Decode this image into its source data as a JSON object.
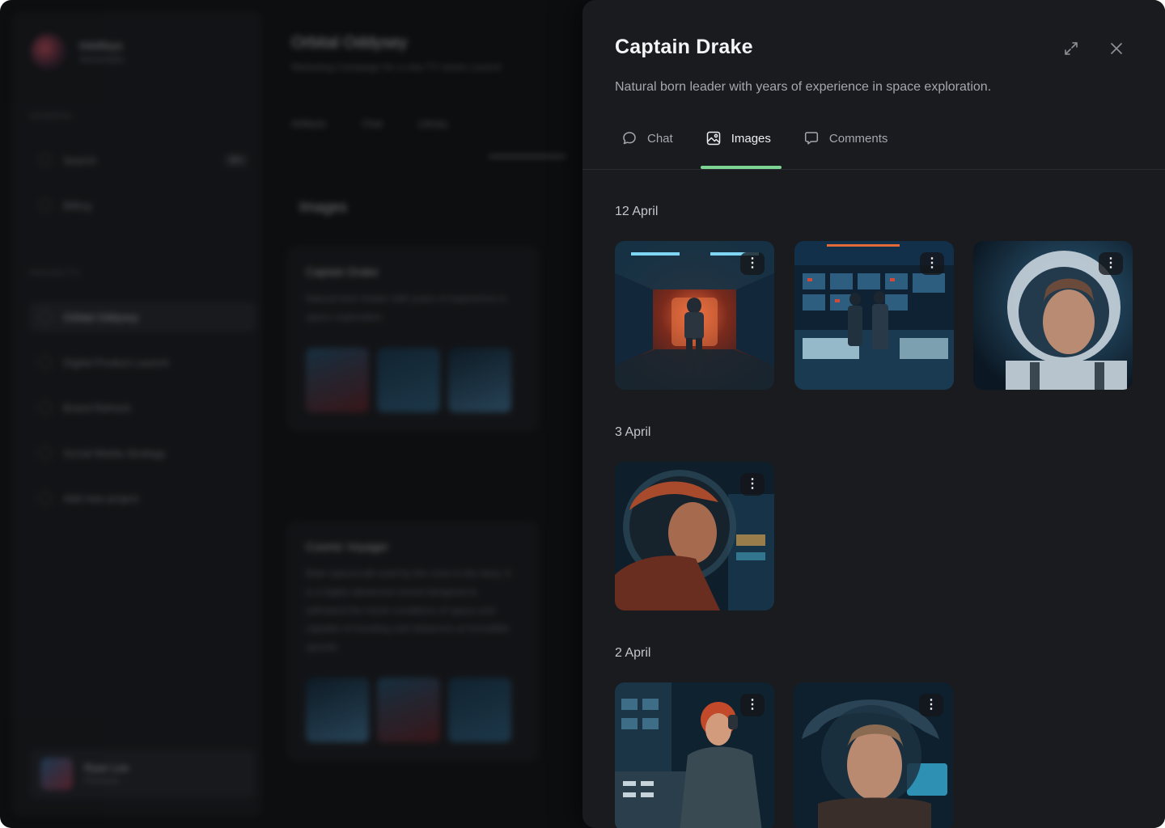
{
  "background_app": {
    "workspace": {
      "name": "Intellisys",
      "sub": "Streamlabs"
    },
    "sections": {
      "general": "GENERAL",
      "projects": "PROJECTS"
    },
    "nav": [
      {
        "label": "Search",
        "kbd": "⌘K"
      },
      {
        "label": "Billing"
      }
    ],
    "projects": [
      {
        "label": "Orbital Oddysey",
        "active": true
      },
      {
        "label": "Digital Product Launch"
      },
      {
        "label": "Brand Refresh"
      },
      {
        "label": "Social Media Strategy"
      },
      {
        "label": "Add new project"
      }
    ],
    "user": {
      "name": "Ryan Lee",
      "plan": "Premium"
    },
    "project_title": "Orbital Oddysey",
    "project_subtitle": "Marketing Campaign for a new TV series Launch",
    "tabs": [
      "Artifacts",
      "Chat",
      "Library"
    ],
    "section_title": "Images",
    "cards": [
      {
        "title": "Captain Drake",
        "desc": "Natural born leader with years of experience in space exploration."
      },
      {
        "title": "Cosmic Voyager",
        "desc": "Main spacecraft used by the crew in the story. It is a highly advanced vessel designed to withstand the harsh conditions of space and capable of traveling vast distances at incredible speeds."
      }
    ]
  },
  "panel": {
    "title": "Captain Drake",
    "description": "Natural born leader with years of experience in space exploration.",
    "expand_icon": "expand-icon",
    "close_icon": "close-icon",
    "tabs": [
      {
        "label": "Chat",
        "icon": "chat-bubble-icon",
        "active": false
      },
      {
        "label": "Images",
        "icon": "image-icon",
        "active": true
      },
      {
        "label": "Comments",
        "icon": "comment-icon",
        "active": false
      }
    ],
    "accent_color": "#7ED493",
    "groups": [
      {
        "date": "12 April",
        "images": [
          {
            "subject": "astronaut-in-corridor",
            "menu": "⋮"
          },
          {
            "subject": "crew-at-control-room",
            "menu": "⋮"
          },
          {
            "subject": "captain-in-helmet",
            "menu": "⋮"
          }
        ]
      },
      {
        "date": "3 April",
        "images": [
          {
            "subject": "astronaut-profile-helmet",
            "menu": "⋮"
          }
        ]
      },
      {
        "date": "2 April",
        "images": [
          {
            "subject": "red-haired-pilot-at-console",
            "menu": "⋮"
          },
          {
            "subject": "woman-in-helmet",
            "menu": "⋮"
          }
        ]
      }
    ]
  }
}
